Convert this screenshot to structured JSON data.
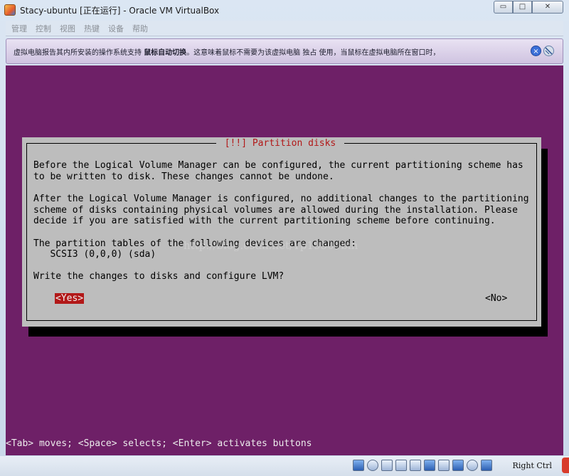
{
  "window": {
    "title": "Stacy-ubuntu [正在运行] - Oracle VM VirtualBox",
    "controls": {
      "minimize": "▭",
      "maximize": "□",
      "close": "✕"
    }
  },
  "menu": {
    "items": [
      "管理",
      "控制",
      "视图",
      "热键",
      "设备",
      "帮助"
    ]
  },
  "notification": {
    "text_before": "虚拟电脑报告其内所安装的操作系统支持 ",
    "text_bold": "鼠标自动切换",
    "text_after": "。这意味着鼠标不需要为该虚拟电脑 独占 使用，当鼠标在虚拟电脑所在窗口时，",
    "close_icon": "×"
  },
  "installer": {
    "dialog_title": "[!!] Partition disks",
    "para1_line1": "Before the Logical Volume Manager can be configured, the current partitioning scheme has",
    "para1_line2": "to be written to disk. These changes cannot be undone.",
    "para2_line1": "After the Logical Volume Manager is configured, no additional changes to the partitioning",
    "para2_line2": "scheme of disks containing physical volumes are allowed during the installation. Please",
    "para2_line3": "decide if you are satisfied with the current partitioning scheme before continuing.",
    "devices_header": "The partition tables of the following devices are changed:",
    "device": "   SCSI3 (0,0,0) (sda)",
    "question": "Write the changes to disks and configure LVM?",
    "yes_button": "<Yes>",
    "no_button": "<No>",
    "watermark": "http://blog.csdn.net/Yp19501bin"
  },
  "status_line": "<Tab> moves; <Space> selects; <Enter> activates buttons",
  "statusbar": {
    "host_key": "Right Ctrl"
  },
  "colors": {
    "vm_background": "#6e2067",
    "dialog_background": "#bdbdbd",
    "title_red": "#b21818"
  }
}
